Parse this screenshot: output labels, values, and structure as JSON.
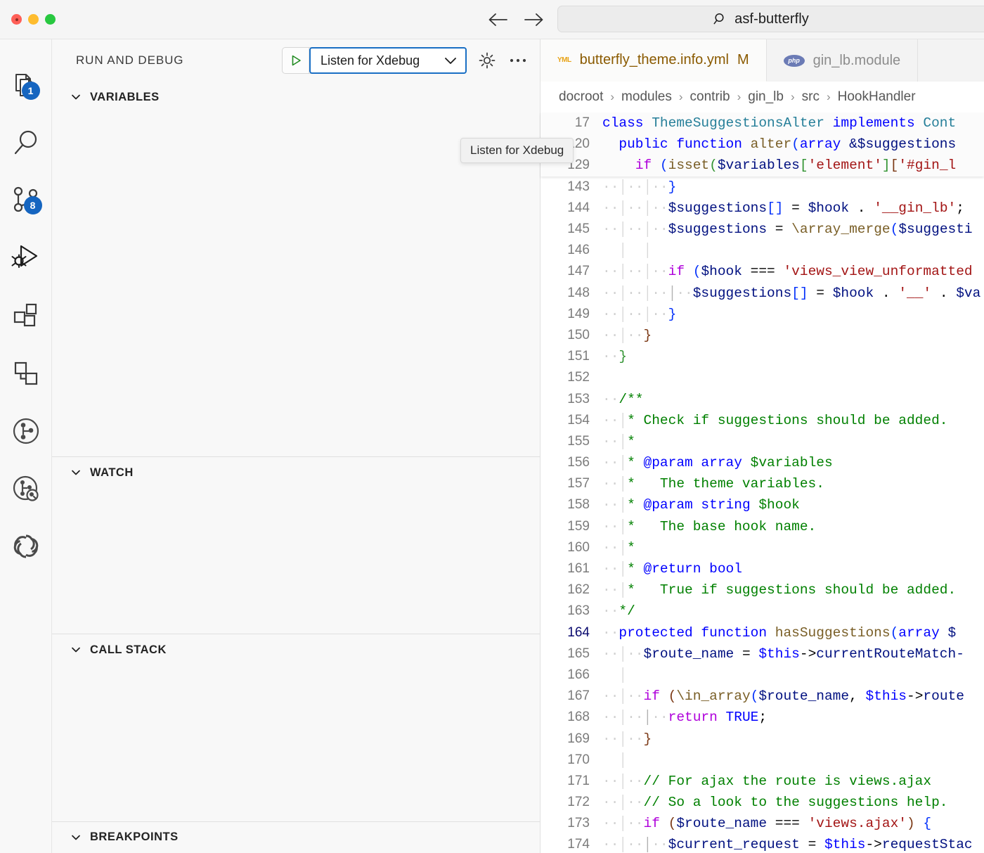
{
  "titlebar": {
    "traffic_lights": [
      "close",
      "minimize",
      "maximize"
    ],
    "back_label": "Back",
    "forward_label": "Forward",
    "search_value": "asf-butterfly",
    "search_icon": "search-icon"
  },
  "activitybar": {
    "items": [
      {
        "icon": "explorer-files-icon",
        "badge": "1"
      },
      {
        "icon": "search-icon",
        "badge": ""
      },
      {
        "icon": "source-control-branch-icon",
        "badge": "8"
      },
      {
        "icon": "run-and-debug-icon",
        "badge": ""
      },
      {
        "icon": "extensions-blocks-icon",
        "badge": ""
      },
      {
        "icon": "remote-explorer-icon",
        "badge": ""
      },
      {
        "icon": "git-graph-circle-icon",
        "badge": ""
      },
      {
        "icon": "git-search-circle-icon",
        "badge": ""
      },
      {
        "icon": "openai-logo-icon",
        "badge": ""
      }
    ]
  },
  "sidebar": {
    "title": "RUN AND DEBUG",
    "launch": {
      "play_label": "Start Debugging",
      "selected": "Listen for Xdebug",
      "chevron": "chevron-down-icon",
      "gear_label": "Open launch.json",
      "more_label": "Views and More Actions..."
    },
    "tooltip": "Listen for Xdebug",
    "panels": [
      {
        "title": "VARIABLES",
        "expanded": true
      },
      {
        "title": "WATCH",
        "expanded": true
      },
      {
        "title": "CALL STACK",
        "expanded": true
      },
      {
        "title": "BREAKPOINTS",
        "expanded": true
      }
    ]
  },
  "editor": {
    "tabs": [
      {
        "label": "butterfly_theme.info.yml",
        "dirty": "M",
        "icon": "yaml-file-icon",
        "active": true
      },
      {
        "label": "gin_lb.module",
        "dirty": "",
        "icon": "php-file-icon",
        "active": false
      }
    ],
    "breadcrumb": [
      "docroot",
      "modules",
      "contrib",
      "gin_lb",
      "src",
      "HookHandler"
    ],
    "breadcrumb_separator": "›",
    "sticky_lines": [
      {
        "num": "17",
        "indent": 0
      },
      {
        "num": "120",
        "indent": 1
      },
      {
        "num": "129",
        "indent": 2
      }
    ],
    "code_lines": [
      {
        "num": "143",
        "breakpoint": false,
        "current": false
      },
      {
        "num": "144",
        "breakpoint": false,
        "current": false
      },
      {
        "num": "145",
        "breakpoint": false,
        "current": false
      },
      {
        "num": "146",
        "breakpoint": false,
        "current": false
      },
      {
        "num": "147",
        "breakpoint": false,
        "current": false
      },
      {
        "num": "148",
        "breakpoint": false,
        "current": false
      },
      {
        "num": "149",
        "breakpoint": false,
        "current": false
      },
      {
        "num": "150",
        "breakpoint": false,
        "current": false
      },
      {
        "num": "151",
        "breakpoint": false,
        "current": false
      },
      {
        "num": "152",
        "breakpoint": false,
        "current": false
      },
      {
        "num": "153",
        "breakpoint": false,
        "current": false
      },
      {
        "num": "154",
        "breakpoint": false,
        "current": false
      },
      {
        "num": "155",
        "breakpoint": false,
        "current": false
      },
      {
        "num": "156",
        "breakpoint": false,
        "current": false
      },
      {
        "num": "157",
        "breakpoint": false,
        "current": false
      },
      {
        "num": "158",
        "breakpoint": false,
        "current": false
      },
      {
        "num": "159",
        "breakpoint": false,
        "current": false
      },
      {
        "num": "160",
        "breakpoint": false,
        "current": false
      },
      {
        "num": "161",
        "breakpoint": false,
        "current": false
      },
      {
        "num": "162",
        "breakpoint": false,
        "current": false
      },
      {
        "num": "163",
        "breakpoint": false,
        "current": false
      },
      {
        "num": "164",
        "breakpoint": false,
        "current": true
      },
      {
        "num": "165",
        "breakpoint": true,
        "current": false
      },
      {
        "num": "166",
        "breakpoint": false,
        "current": false
      },
      {
        "num": "167",
        "breakpoint": false,
        "current": false
      },
      {
        "num": "168",
        "breakpoint": false,
        "current": false
      },
      {
        "num": "169",
        "breakpoint": false,
        "current": false
      },
      {
        "num": "170",
        "breakpoint": false,
        "current": false
      },
      {
        "num": "171",
        "breakpoint": false,
        "current": false
      },
      {
        "num": "172",
        "breakpoint": false,
        "current": false
      },
      {
        "num": "173",
        "breakpoint": false,
        "current": false
      },
      {
        "num": "174",
        "breakpoint": false,
        "current": false
      }
    ],
    "source_text": {
      "l17": "class ThemeSuggestionsAlter implements Cont",
      "l120": "  public function alter(array &$suggestions",
      "l129": "    if (isset($variables['element']['#gin_l",
      "l143": "      }",
      "l144": "      $suggestions[] = $hook . '__gin_lb';",
      "l145": "      $suggestions = \\array_merge($suggesti",
      "l146": "",
      "l147": "      if ($hook === 'views_view_unformatted",
      "l148": "        $suggestions[] = $hook . '__' . $va",
      "l149": "      }",
      "l150": "    }",
      "l151": "  }",
      "l152": "",
      "l153": "  /**",
      "l154": "   * Check if suggestions should be added.",
      "l155": "   *",
      "l156": "   * @param array $variables",
      "l157": "   *   The theme variables.",
      "l158": "   * @param string $hook",
      "l159": "   *   The base hook name.",
      "l160": "   *",
      "l161": "   * @return bool",
      "l162": "   *   True if suggestions should be added.",
      "l163": "   */",
      "l164": "  protected function hasSuggestions(array $",
      "l165": "    $route_name = $this->currentRouteMatch-",
      "l166": "",
      "l167": "    if (\\in_array($route_name, $this->route",
      "l168": "      return TRUE;",
      "l169": "    }",
      "l170": "",
      "l171": "    // For ajax the route is views.ajax",
      "l172": "    // So a look to the suggestions help.",
      "l173": "    if ($route_name === 'views.ajax') {",
      "l174": "      $current_request = $this->requestStac"
    }
  },
  "colors": {
    "accent_blue": "#1a6fc4",
    "badge_blue": "#1565c0",
    "breakpoint_red": "#e51400",
    "play_green": "#218a21",
    "tab_active_text": "#8a5a00",
    "comment_green": "#008000",
    "string_red": "#a31515",
    "keyword_blue": "#0000ff",
    "control_purple": "#af00db",
    "function_gold": "#795e26",
    "variable_navy": "#001080",
    "type_teal": "#267f99"
  }
}
